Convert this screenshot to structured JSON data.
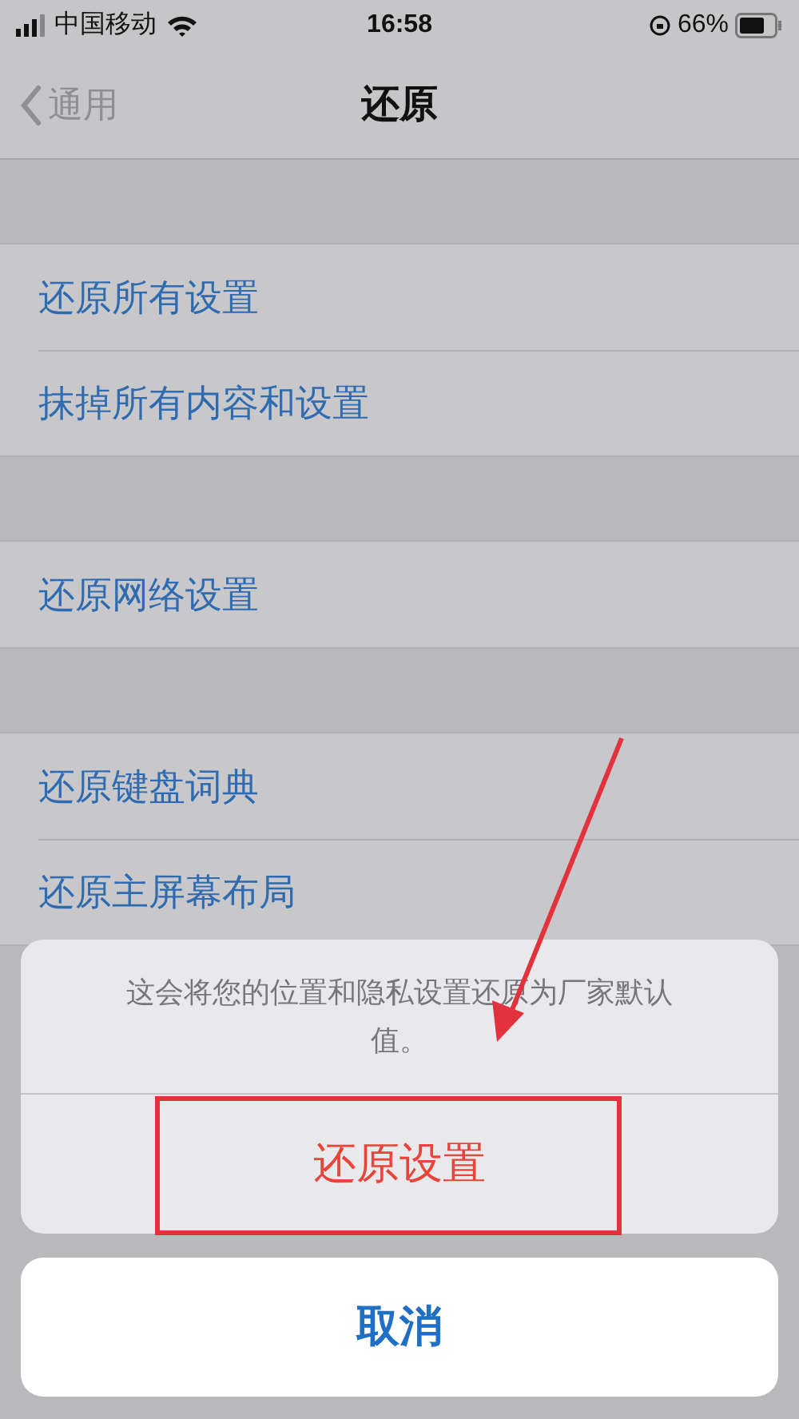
{
  "status_bar": {
    "carrier": "中国移动",
    "time": "16:58",
    "battery": "66%"
  },
  "nav": {
    "back": "通用",
    "title": "还原"
  },
  "groups": [
    [
      "还原所有设置",
      "抹掉所有内容和设置"
    ],
    [
      "还原网络设置"
    ],
    [
      "还原键盘词典",
      "还原主屏幕布局"
    ]
  ],
  "action_sheet": {
    "message": "这会将您的位置和隐私设置还原为厂家默认值。",
    "action": "还原设置",
    "cancel": "取消"
  }
}
